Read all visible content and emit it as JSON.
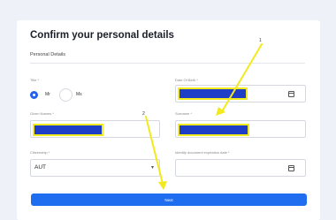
{
  "page": {
    "title": "Confirm your personal details",
    "section": "Personal Details"
  },
  "fields": {
    "title_label": "Title *",
    "title_options": [
      "Mr",
      "Ms"
    ],
    "title_selected": "Mr",
    "dob_label": "Date Of Birth *",
    "given_names_label": "Given Names *",
    "surname_label": "Surname *",
    "citizenship_label": "Citizenship *",
    "citizenship_value": "AUT",
    "expiry_label": "Identity document expiration date *"
  },
  "buttons": {
    "next": "Next"
  },
  "annotations": {
    "marker1": "1",
    "marker2": "2"
  },
  "colors": {
    "highlight_fill": "#1e3ec8",
    "highlight_border": "#f2ea1c",
    "primary": "#1f6ef0",
    "arrow": "#f2ea1c"
  }
}
